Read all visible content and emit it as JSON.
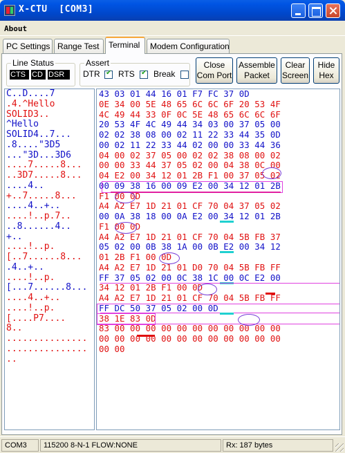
{
  "window": {
    "title": "X-CTU  [COM3]"
  },
  "menu": {
    "about": "About"
  },
  "tabs": [
    {
      "label": "PC Settings"
    },
    {
      "label": "Range Test"
    },
    {
      "label": "Terminal",
      "active": true
    },
    {
      "label": "Modem Configuration"
    }
  ],
  "line_status": {
    "legend": "Line Status",
    "cts": "CTS",
    "cd": "CD",
    "dsr": "DSR"
  },
  "assert": {
    "legend": "Assert",
    "dtr": {
      "label": "DTR",
      "checked": true
    },
    "rts": {
      "label": "RTS",
      "checked": true
    },
    "break": {
      "label": "Break",
      "checked": false
    }
  },
  "buttons": {
    "close_port_1": "Close",
    "close_port_2": "Com Port",
    "assemble_1": "Assemble",
    "assemble_2": "Packet",
    "clear_1": "Clear",
    "clear_2": "Screen",
    "hide_1": "Hide",
    "hide_2": "Hex"
  },
  "terminal": {
    "ascii_lines": [
      {
        "text": "C..D....7",
        "color": "blue"
      },
      {
        "text": ".4.^Hello",
        "color": "red"
      },
      {
        "text": "SOLID3..",
        "color": "red"
      },
      {
        "text": "^Hello",
        "color": "blue"
      },
      {
        "text": "SOLID4..7...",
        "color": "blue"
      },
      {
        "text": ".8....\"3D5",
        "color": "blue"
      },
      {
        "text": "...\"3D...3D6",
        "color": "blue"
      },
      {
        "text": "....7.....8...",
        "color": "red"
      },
      {
        "text": "..3D7.....8...",
        "color": "red"
      },
      {
        "text": "....4..",
        "color": "blue"
      },
      {
        "text": "+..7.....8...",
        "color": "red"
      },
      {
        "text": "....4..+..",
        "color": "blue"
      },
      {
        "text": "....!..p.7..",
        "color": "red"
      },
      {
        "text": "..8......4..",
        "color": "blue"
      },
      {
        "text": "+..",
        "color": "blue"
      },
      {
        "text": "....!..p.",
        "color": "red"
      },
      {
        "text": "[..7......8...",
        "color": "red"
      },
      {
        "text": ".4..+..",
        "color": "blue"
      },
      {
        "text": "....!..p.",
        "color": "red"
      },
      {
        "text": "[...7......8...",
        "color": "blue"
      },
      {
        "text": "....4..+..",
        "color": "red"
      },
      {
        "text": "....!..p.",
        "color": "red"
      },
      {
        "text": "[....P7....",
        "color": "red"
      },
      {
        "text": "8..",
        "color": "red"
      },
      {
        "text": "...............",
        "color": "red"
      },
      {
        "text": "...............",
        "color": "red"
      },
      {
        "text": "..",
        "color": "red"
      }
    ],
    "hex_lines": [
      {
        "text": "43 03 01 44 16 01 F7 FC 37 0D",
        "color": "blue"
      },
      {
        "text": "0E 34 00 5E 48 65 6C 6C 6F 20 53 4F",
        "color": "red"
      },
      {
        "text": "4C 49 44 33 0F 0C 5E 48 65 6C 6C 6F",
        "color": "red"
      },
      {
        "text": "20 53 4F 4C 49 44 34 03 00 37 05 00",
        "color": "blue"
      },
      {
        "text": "02 02 38 08 00 02 11 22 33 44 35 0D",
        "color": "blue"
      },
      {
        "text": "00 02 11 22 33 44 02 00 00 33 44 36",
        "color": "blue"
      },
      {
        "text": "04 00 02 37 05 00 02 02 38 08 00 02",
        "color": "red"
      },
      {
        "text": "00 00 33 44 37 05 02 00 04 38 0C 00",
        "color": "red"
      },
      {
        "text": "04 E2 00 34 12 01 2B F1 00 37 05 02",
        "color": "red"
      },
      {
        "text": "00 09 38 16 00 09 E2 00 34 12 01 2B",
        "color": "blue"
      },
      {
        "text": "F1 00 0D",
        "color": "red"
      },
      {
        "text": "A4 A2 E7 1D 21 01 CF 70 04 37 05 02",
        "color": "red"
      },
      {
        "text": "00 0A 38 18 00 0A E2 00 34 12 01 2B",
        "color": "blue"
      },
      {
        "text": "F1 00 0D",
        "color": "red"
      },
      {
        "text": "A4 A2 E7 1D 21 01 CF 70 04 5B FB 37",
        "color": "red"
      },
      {
        "text": "05 02 00 0B 38 1A 00 0B E2 00 34 12",
        "color": "blue"
      },
      {
        "text": "01 2B F1 00 0D",
        "color": "red"
      },
      {
        "text": "A4 A2 E7 1D 21 01 D0 70 04 5B FB FF",
        "color": "red"
      },
      {
        "text": "FF 37 05 02 00 0C 38 1C 00 0C E2 00",
        "color": "blue"
      },
      {
        "text": "34 12 01 2B F1 00 0D",
        "color": "red"
      },
      {
        "text": "A4 A2 E7 1D 21 01 CF 70 04 5B FB FF",
        "color": "red"
      },
      {
        "text": "FF DC 50 37 05 02 00 0D",
        "color": "blue"
      },
      {
        "text": "38 1E 83 0D",
        "color": "red"
      },
      {
        "text": "83 00 00 00 00 00 00 00 00 00 00 00",
        "color": "red"
      },
      {
        "text": "00 00 00 00 00 00 00 00 00 00 00 00",
        "color": "red"
      },
      {
        "text": "00 00",
        "color": "red"
      }
    ]
  },
  "statusbar": {
    "port": "COM3",
    "settings": "115200 8-N-1  FLOW:NONE",
    "rx": "Rx: 187 bytes"
  },
  "colors": {
    "red": "#e01010",
    "blue": "#1010c8",
    "title_bar": "#0054e3",
    "annotation_box": "#e040e0"
  }
}
